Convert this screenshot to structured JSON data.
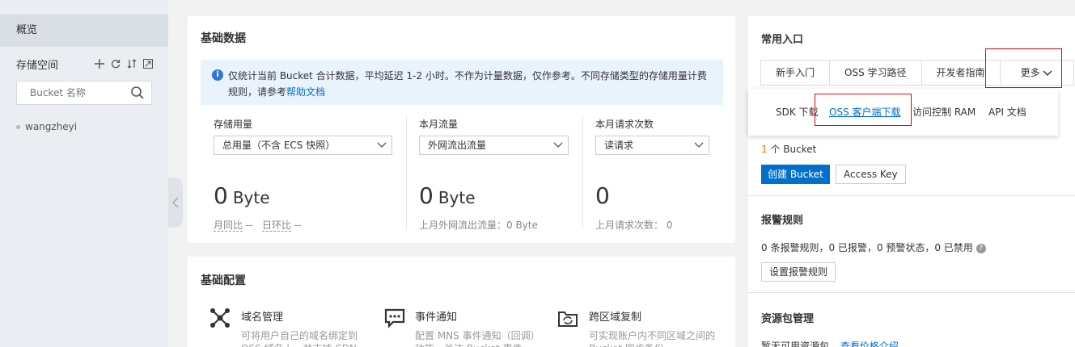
{
  "top": {
    "crumb": "",
    "right": ""
  },
  "sidebar": {
    "top_cut_label": "",
    "overview": "概览",
    "storage_space": "存储空间",
    "search_placeholder": "Bucket 名称",
    "buckets": [
      "wangzheyi"
    ]
  },
  "basic_data": {
    "title": "基础数据",
    "info_text": "仅统计当前 Bucket 合计数据，平均延迟 1-2 小时。不作为计量数据，仅作参考。不同存储类型的存储用量计费规则，请参考",
    "info_link": "帮助文档",
    "metrics": [
      {
        "label": "存储用量",
        "select": "总用量（不含 ECS 快照）",
        "value": "0",
        "unit": "Byte",
        "mom": "月同比",
        "mom_val": "--",
        "dod": "日环比",
        "dod_val": "--"
      },
      {
        "label": "本月流量",
        "select": "外网流出流量",
        "value": "0",
        "unit": "Byte",
        "note": "上月外网流出流量：0 Byte"
      },
      {
        "label": "本月请求次数",
        "select": "读请求",
        "value": "0",
        "note": "上月请求次数：  0"
      }
    ]
  },
  "basic_config": {
    "title": "基础配置",
    "items": [
      {
        "title": "域名管理",
        "desc": "可将用户自己的域名绑定到 OSS 域名上，并支持 CDN"
      },
      {
        "title": "事件通知",
        "desc": "配置 MNS 事件通知（回调）功能，关注 Bucket 事件"
      },
      {
        "title": "跨区域复制",
        "desc": "可实现账户内不同区域之间的 Bucket 同步备份"
      }
    ]
  },
  "common_entry": {
    "title": "常用入口",
    "tabs": [
      "新手入门",
      "OSS 学习路径",
      "开发者指南",
      "更多"
    ],
    "dropdown": [
      "SDK 下载",
      "OSS 客户端下载",
      "访问控制 RAM",
      "API 文档"
    ]
  },
  "bucket_summary": {
    "count": "1",
    "count_suffix": " 个 Bucket",
    "create_button": "创建 Bucket",
    "access_key_button": "Access Key"
  },
  "alarm": {
    "title": "报警规则",
    "summary": "0 条报警规则，0 已报警，0 预警状态，0 已禁用",
    "button": "设置报警规则"
  },
  "resource": {
    "title": "资源包管理",
    "text": "暂无可用资源包",
    "link": "查看价格介绍"
  },
  "colors": {
    "primary": "#0070cc",
    "highlight": "#e60012",
    "accent": "#f56c00"
  }
}
